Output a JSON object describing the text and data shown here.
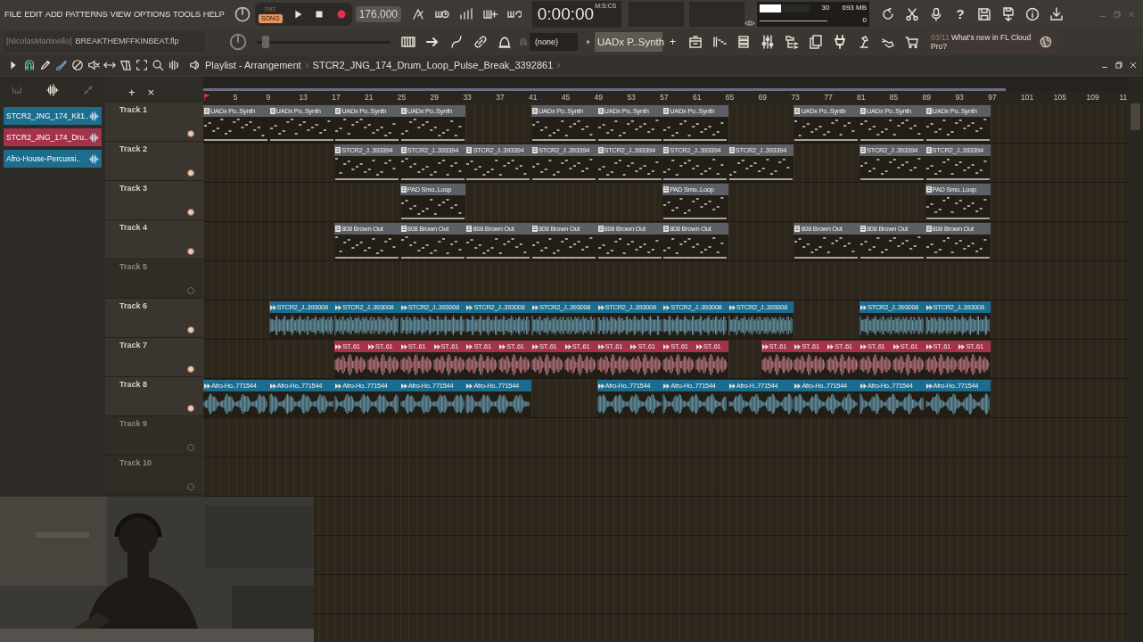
{
  "menu": [
    "FILE",
    "EDIT",
    "ADD",
    "PATTERNS",
    "VIEW",
    "OPTIONS",
    "TOOLS",
    "HELP"
  ],
  "transport": {
    "modes": [
      {
        "label": "PAT",
        "selected": false
      },
      {
        "label": "SONG",
        "selected": true
      }
    ],
    "tempo": "176.000"
  },
  "time": {
    "value": "0:00:00",
    "unit": "M:S:CS"
  },
  "monitor": {
    "cpu": {
      "level": 0.42,
      "reading": "30"
    },
    "memory": "693 MB",
    "polyphony": "0"
  },
  "help_label": "?",
  "project": {
    "user": "[NicolasMartinello]",
    "file": "BREAKTHEMFFKINBEAT.flp"
  },
  "pitch": {
    "level": 0.04
  },
  "snap": "(none)",
  "current_pattern": "UADx P..Synth",
  "add_label": "+",
  "news": {
    "date": "03/11",
    "text": "What's new in FL Cloud Pro?"
  },
  "playlist": {
    "title": "Playlist - Arrangement",
    "clip_name": "STCR2_JNG_174_Drum_Loop_Pulse_Break_3392861",
    "picker": [
      {
        "name": "STCR2_JNG_174_Kit1..",
        "color": "#1d6d8e"
      },
      {
        "name": "STCR2_JNG_174_Dru..",
        "color": "#a3324a"
      },
      {
        "name": "Afro-House-Percussi..",
        "color": "#1d6d8e"
      }
    ],
    "header_buttons": [
      "+",
      "×"
    ],
    "ruler": [
      "5",
      "9",
      "13",
      "17",
      "21",
      "25",
      "29",
      "33",
      "37",
      "41",
      "45",
      "49",
      "53",
      "57",
      "61",
      "65",
      "69",
      "73",
      "77",
      "81",
      "85",
      "89",
      "93",
      "97",
      "101",
      "105",
      "109",
      "11"
    ],
    "tracks": [
      {
        "name": "Track 1",
        "active": true,
        "clips": [
          {
            "kind": "pattern",
            "label": "UADx Po..Synth",
            "color": "#5c6066",
            "long": true
          },
          {
            "kind": "pattern",
            "label": "UADx Po..Synth",
            "color": "#5c6066",
            "long": true
          },
          {
            "kind": "pattern",
            "label": "UADx Po..Synth",
            "color": "#5c6066",
            "long": true
          },
          {
            "kind": "pattern",
            "label": "UADx Po..Synth",
            "color": "#5c6066",
            "long": true
          },
          {
            "kind": "gap"
          },
          {
            "kind": "gap"
          },
          {
            "kind": "pattern",
            "label": "UADx Po..Synth",
            "color": "#5c6066",
            "long": true
          },
          {
            "kind": "pattern",
            "label": "UADx Po..Synth",
            "color": "#5c6066",
            "long": true
          },
          {
            "kind": "pattern",
            "label": "UADx Po..Synth",
            "color": "#5c6066",
            "long": true
          },
          {
            "kind": "gap"
          },
          {
            "kind": "gap"
          },
          {
            "kind": "pattern",
            "label": "UADx Po..Synth",
            "color": "#5c6066",
            "long": true
          },
          {
            "kind": "pattern",
            "label": "UADx Po..Synth",
            "color": "#5c6066",
            "long": true
          },
          {
            "kind": "pattern",
            "label": "UADx Po..Synth",
            "color": "#5c6066",
            "long": true
          }
        ]
      },
      {
        "name": "Track 2",
        "active": true,
        "clips": [
          {
            "kind": "gap"
          },
          {
            "kind": "gap"
          },
          {
            "kind": "gap"
          },
          {
            "kind": "gap"
          },
          {
            "kind": "pattern",
            "label": "STCR2_J..393394",
            "color": "#5c6066",
            "long": true
          },
          {
            "kind": "pattern",
            "label": "STCR2_J..393394",
            "color": "#5c6066",
            "long": true
          },
          {
            "kind": "pattern",
            "label": "STCR2_J..393394",
            "color": "#5c6066",
            "long": true
          },
          {
            "kind": "pattern",
            "label": "STCR2_J..393394",
            "color": "#5c6066",
            "long": true
          },
          {
            "kind": "pattern",
            "label": "STCR2_J..393394",
            "color": "#5c6066",
            "long": true
          },
          {
            "kind": "pattern",
            "label": "STCR2_J..393394",
            "color": "#5c6066",
            "long": true
          },
          {
            "kind": "pattern",
            "label": "STCR2_J..393394",
            "color": "#5c6066",
            "long": true
          },
          {
            "kind": "gap"
          },
          {
            "kind": "gap"
          },
          {
            "kind": "pattern",
            "label": "STCR2_J..393394",
            "color": "#5c6066",
            "long": true
          },
          {
            "kind": "pattern",
            "label": "STCR2_J..393394",
            "color": "#5c6066",
            "long": true
          }
        ]
      },
      {
        "name": "Track 3",
        "active": true,
        "clips": [
          {
            "kind": "gap"
          },
          {
            "kind": "gap"
          },
          {
            "kind": "gap"
          },
          {
            "kind": "gap"
          },
          {
            "kind": "gap"
          },
          {
            "kind": "gap"
          },
          {
            "kind": "pattern",
            "label": "PAD Smo..Loop",
            "color": "#5c6066",
            "long": true
          },
          {
            "kind": "gap"
          },
          {
            "kind": "gap"
          },
          {
            "kind": "gap"
          },
          {
            "kind": "gap"
          },
          {
            "kind": "gap"
          },
          {
            "kind": "gap"
          },
          {
            "kind": "pattern",
            "label": "PAD Smo..Loop",
            "color": "#5c6066",
            "long": true
          },
          {
            "kind": "gap"
          },
          {
            "kind": "gap"
          },
          {
            "kind": "gap"
          },
          {
            "kind": "gap"
          },
          {
            "kind": "gap"
          },
          {
            "kind": "gap"
          },
          {
            "kind": "pattern",
            "label": "PAD Smo..Loop",
            "color": "#5c6066",
            "long": true
          }
        ]
      },
      {
        "name": "Track 4",
        "active": true,
        "clips": [
          {
            "kind": "gap"
          },
          {
            "kind": "gap"
          },
          {
            "kind": "gap"
          },
          {
            "kind": "gap"
          },
          {
            "kind": "pattern",
            "label": "808 Brown Out",
            "color": "#5c6066",
            "long": true
          },
          {
            "kind": "pattern",
            "label": "808 Brown Out",
            "color": "#5c6066",
            "long": true
          },
          {
            "kind": "pattern",
            "label": "808 Brown Out",
            "color": "#5c6066",
            "long": true
          },
          {
            "kind": "pattern",
            "label": "808 Brown Out",
            "color": "#5c6066",
            "long": true
          },
          {
            "kind": "pattern",
            "label": "808 Brown Out",
            "color": "#5c6066",
            "long": true
          },
          {
            "kind": "pattern",
            "label": "808 Brown Out",
            "color": "#5c6066",
            "long": true
          },
          {
            "kind": "gap"
          },
          {
            "kind": "gap"
          },
          {
            "kind": "pattern",
            "label": "808 Brown Out",
            "color": "#5c6066",
            "long": true
          },
          {
            "kind": "pattern",
            "label": "808 Brown Out",
            "color": "#5c6066",
            "long": true
          },
          {
            "kind": "pattern",
            "label": "808 Brown Out",
            "color": "#5c6066",
            "long": true
          }
        ]
      },
      {
        "name": "Track 5",
        "active": false
      },
      {
        "name": "Track 6",
        "active": true,
        "clips": [
          {
            "kind": "gap"
          },
          {
            "kind": "gap"
          },
          {
            "kind": "audio",
            "label": "STCR2_J..393008",
            "color": "#1b6d8f",
            "long": true
          },
          {
            "kind": "audio",
            "label": "STCR2_J..393008",
            "color": "#1b6d8f",
            "long": true
          },
          {
            "kind": "audio",
            "label": "STCR2_J..393008",
            "color": "#1b6d8f",
            "long": true
          },
          {
            "kind": "audio",
            "label": "STCR2_J..393008",
            "color": "#1b6d8f",
            "long": true
          },
          {
            "kind": "audio",
            "label": "STCR2_J..393008",
            "color": "#1b6d8f",
            "long": true
          },
          {
            "kind": "audio",
            "label": "STCR2_J..393008",
            "color": "#1b6d8f",
            "long": true
          },
          {
            "kind": "audio",
            "label": "STCR2_J..393008",
            "color": "#1b6d8f",
            "long": true
          },
          {
            "kind": "audio",
            "label": "STCR2_J..393008",
            "color": "#1b6d8f",
            "long": true
          },
          {
            "kind": "gap"
          },
          {
            "kind": "gap"
          },
          {
            "kind": "audio",
            "label": "STCR2_J..393008",
            "color": "#1b6d8f",
            "long": true
          },
          {
            "kind": "audio",
            "label": "STCR2_J..393008",
            "color": "#1b6d8f",
            "long": true
          }
        ]
      },
      {
        "name": "Track 7",
        "active": true,
        "clips": [
          {
            "kind": "gap"
          },
          {
            "kind": "gap"
          },
          {
            "kind": "gap"
          },
          {
            "kind": "gap"
          },
          {
            "kind": "audio",
            "label": "ST..61",
            "color": "#a3324a",
            "long": false
          },
          {
            "kind": "audio",
            "label": "ST..61",
            "color": "#a3324a",
            "long": false
          },
          {
            "kind": "audio",
            "label": "ST..61",
            "color": "#a3324a",
            "long": false
          },
          {
            "kind": "audio",
            "label": "ST..61",
            "color": "#a3324a",
            "long": false
          },
          {
            "kind": "audio",
            "label": "ST..61",
            "color": "#a3324a",
            "long": false
          },
          {
            "kind": "audio",
            "label": "ST..61",
            "color": "#a3324a",
            "long": false
          },
          {
            "kind": "audio",
            "label": "ST..61",
            "color": "#a3324a",
            "long": false
          },
          {
            "kind": "audio",
            "label": "ST..61",
            "color": "#a3324a",
            "long": false
          },
          {
            "kind": "audio",
            "label": "ST..61",
            "color": "#a3324a",
            "long": false
          },
          {
            "kind": "audio",
            "label": "ST..61",
            "color": "#a3324a",
            "long": false
          },
          {
            "kind": "audio",
            "label": "ST..61",
            "color": "#a3324a",
            "long": false
          },
          {
            "kind": "audio",
            "label": "ST..61",
            "color": "#a3324a",
            "long": false
          },
          {
            "kind": "gap"
          },
          {
            "kind": "audio",
            "label": "ST..61",
            "color": "#a3324a",
            "long": false
          },
          {
            "kind": "audio",
            "label": "ST..61",
            "color": "#a3324a",
            "long": false
          },
          {
            "kind": "audio",
            "label": "ST..61",
            "color": "#a3324a",
            "long": false
          },
          {
            "kind": "audio",
            "label": "ST..61",
            "color": "#a3324a",
            "long": false
          },
          {
            "kind": "audio",
            "label": "ST..61",
            "color": "#a3324a",
            "long": false
          },
          {
            "kind": "audio",
            "label": "ST..61",
            "color": "#a3324a",
            "long": false
          },
          {
            "kind": "audio",
            "label": "ST..61",
            "color": "#a3324a",
            "long": false
          }
        ]
      },
      {
        "name": "Track 8",
        "active": true,
        "clips": [
          {
            "kind": "audio",
            "label": "Afro-Ho..771544",
            "color": "#1b6d8f",
            "long": true
          },
          {
            "kind": "audio",
            "label": "Afro-Ho..771544",
            "color": "#1b6d8f",
            "long": true
          },
          {
            "kind": "audio",
            "label": "Afro-Ho..771544",
            "color": "#1b6d8f",
            "long": true
          },
          {
            "kind": "audio",
            "label": "Afro-Ho..771544",
            "color": "#1b6d8f",
            "long": true
          },
          {
            "kind": "audio",
            "label": "Afro-Ho..771544",
            "color": "#1b6d8f",
            "long": true
          },
          {
            "kind": "gap"
          },
          {
            "kind": "gap"
          },
          {
            "kind": "audio",
            "label": "Afro-Ho..771544",
            "color": "#1b6d8f",
            "long": true
          },
          {
            "kind": "audio",
            "label": "Afro-Ho..771544",
            "color": "#1b6d8f",
            "long": true
          },
          {
            "kind": "audio",
            "label": "Afro-H..771544",
            "color": "#1b6d8f",
            "long": true
          },
          {
            "kind": "audio",
            "label": "Afro-Ho..771544",
            "color": "#1b6d8f",
            "long": true
          },
          {
            "kind": "audio",
            "label": "Afro-Ho..771544",
            "color": "#1b6d8f",
            "long": true
          },
          {
            "kind": "audio",
            "label": "Afro-Ho..771544",
            "color": "#1b6d8f",
            "long": true
          }
        ]
      },
      {
        "name": "Track 9",
        "active": false
      },
      {
        "name": "Track 10",
        "active": false
      }
    ]
  }
}
